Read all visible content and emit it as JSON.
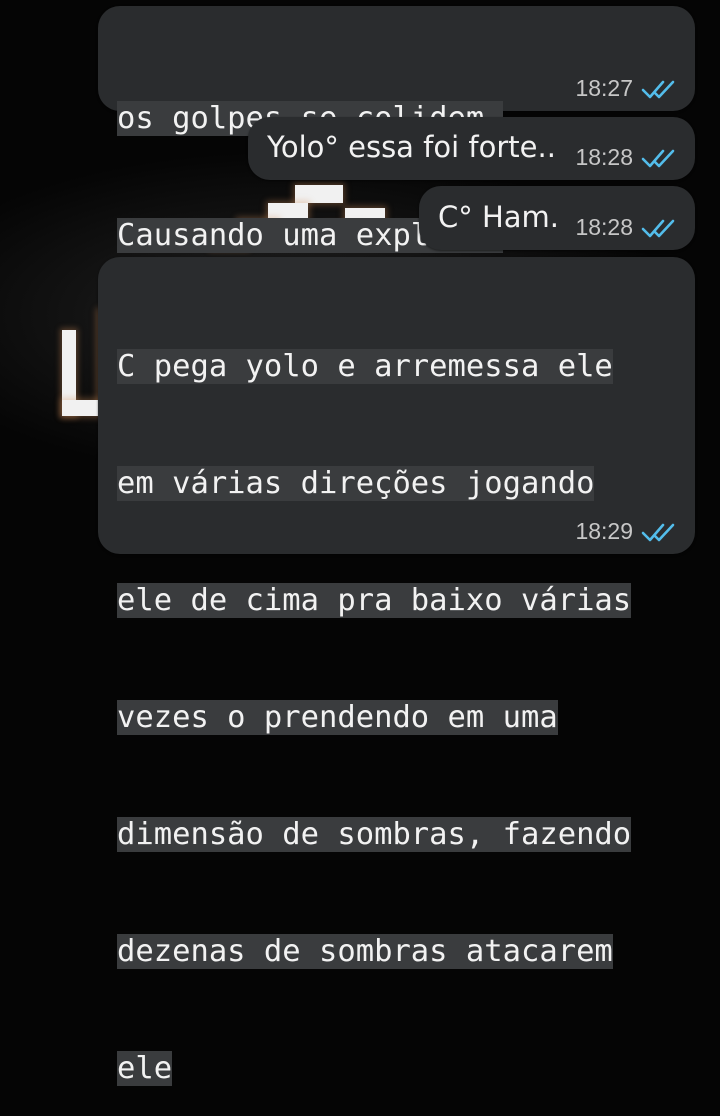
{
  "colors": {
    "bubble": "#2a2c2e",
    "text": "#f2f2f2",
    "timestamp": "#c7c7c7",
    "read_ticks": "#53bdeb",
    "background": "#050505"
  },
  "messages": [
    {
      "lines": [
        "os golpes se colidem.",
        "Causando uma explosão"
      ],
      "time": "18:27",
      "status_icon": "double-check-read-icon"
    },
    {
      "text": "Yolo° essa foi forte..",
      "time": "18:28",
      "status_icon": "double-check-read-icon"
    },
    {
      "text": "C° Ham.",
      "time": "18:28",
      "status_icon": "double-check-read-icon"
    },
    {
      "lines": [
        "C pega yolo e arremessa ele",
        "em várias direções jogando",
        "ele de cima pra baixo várias",
        "vezes o prendendo em uma",
        "dimensão de sombras, fazendo",
        "dezenas de sombras atacarem",
        "ele"
      ],
      "time": "18:29",
      "status_icon": "double-check-read-icon"
    }
  ]
}
